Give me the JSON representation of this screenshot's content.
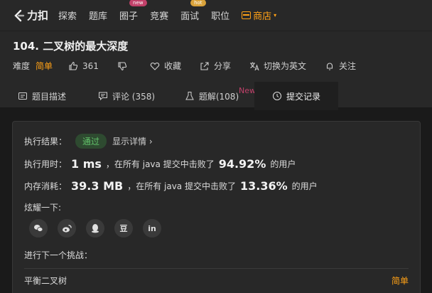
{
  "nav": {
    "logo_text": "力扣",
    "items": [
      {
        "label": "探索"
      },
      {
        "label": "题库"
      },
      {
        "label": "圈子",
        "badge": "new"
      },
      {
        "label": "竞赛"
      },
      {
        "label": "面试",
        "badge": "hot"
      },
      {
        "label": "职位"
      }
    ],
    "store_label": "商店",
    "caret": "▾"
  },
  "problem": {
    "title": "104. 二叉树的最大深度",
    "difficulty_label": "难度",
    "difficulty": "简单",
    "likes": "361",
    "favorite": "收藏",
    "share": "分享",
    "translate": "切换为英文",
    "follow": "关注"
  },
  "tabs": [
    {
      "label": "题目描述"
    },
    {
      "label": "评论 (358)"
    },
    {
      "label": "题解(108)",
      "tag": "New"
    },
    {
      "label": "提交记录"
    }
  ],
  "result": {
    "label": "执行结果：",
    "status": "通过",
    "detail_link": "显示详情 ›",
    "runtime_label": "执行用时：",
    "runtime_value": "1 ms",
    "runtime_mid": "，在所有 java 提交中击败了",
    "runtime_percent": "94.92%",
    "runtime_suffix": "的用户",
    "memory_label": "内存消耗：",
    "memory_value": "39.3 MB",
    "memory_mid": "，在所有 java 提交中击败了",
    "memory_percent": "13.36%",
    "memory_suffix": "的用户",
    "share_label": "炫耀一下:",
    "share_icons": [
      "wechat-icon",
      "weibo-icon",
      "qq-icon",
      "douban-icon",
      "linkedin-icon"
    ],
    "douban_glyph": "豆",
    "linkedin_glyph": "in",
    "next_label": "进行下一个挑战：",
    "next_problem": "平衡二叉树",
    "next_difficulty": "简单"
  },
  "colors": {
    "accent": "#ffa116",
    "success": "#62c26a",
    "badge_new": "#c2416a",
    "badge_hot": "#d9a23a"
  }
}
